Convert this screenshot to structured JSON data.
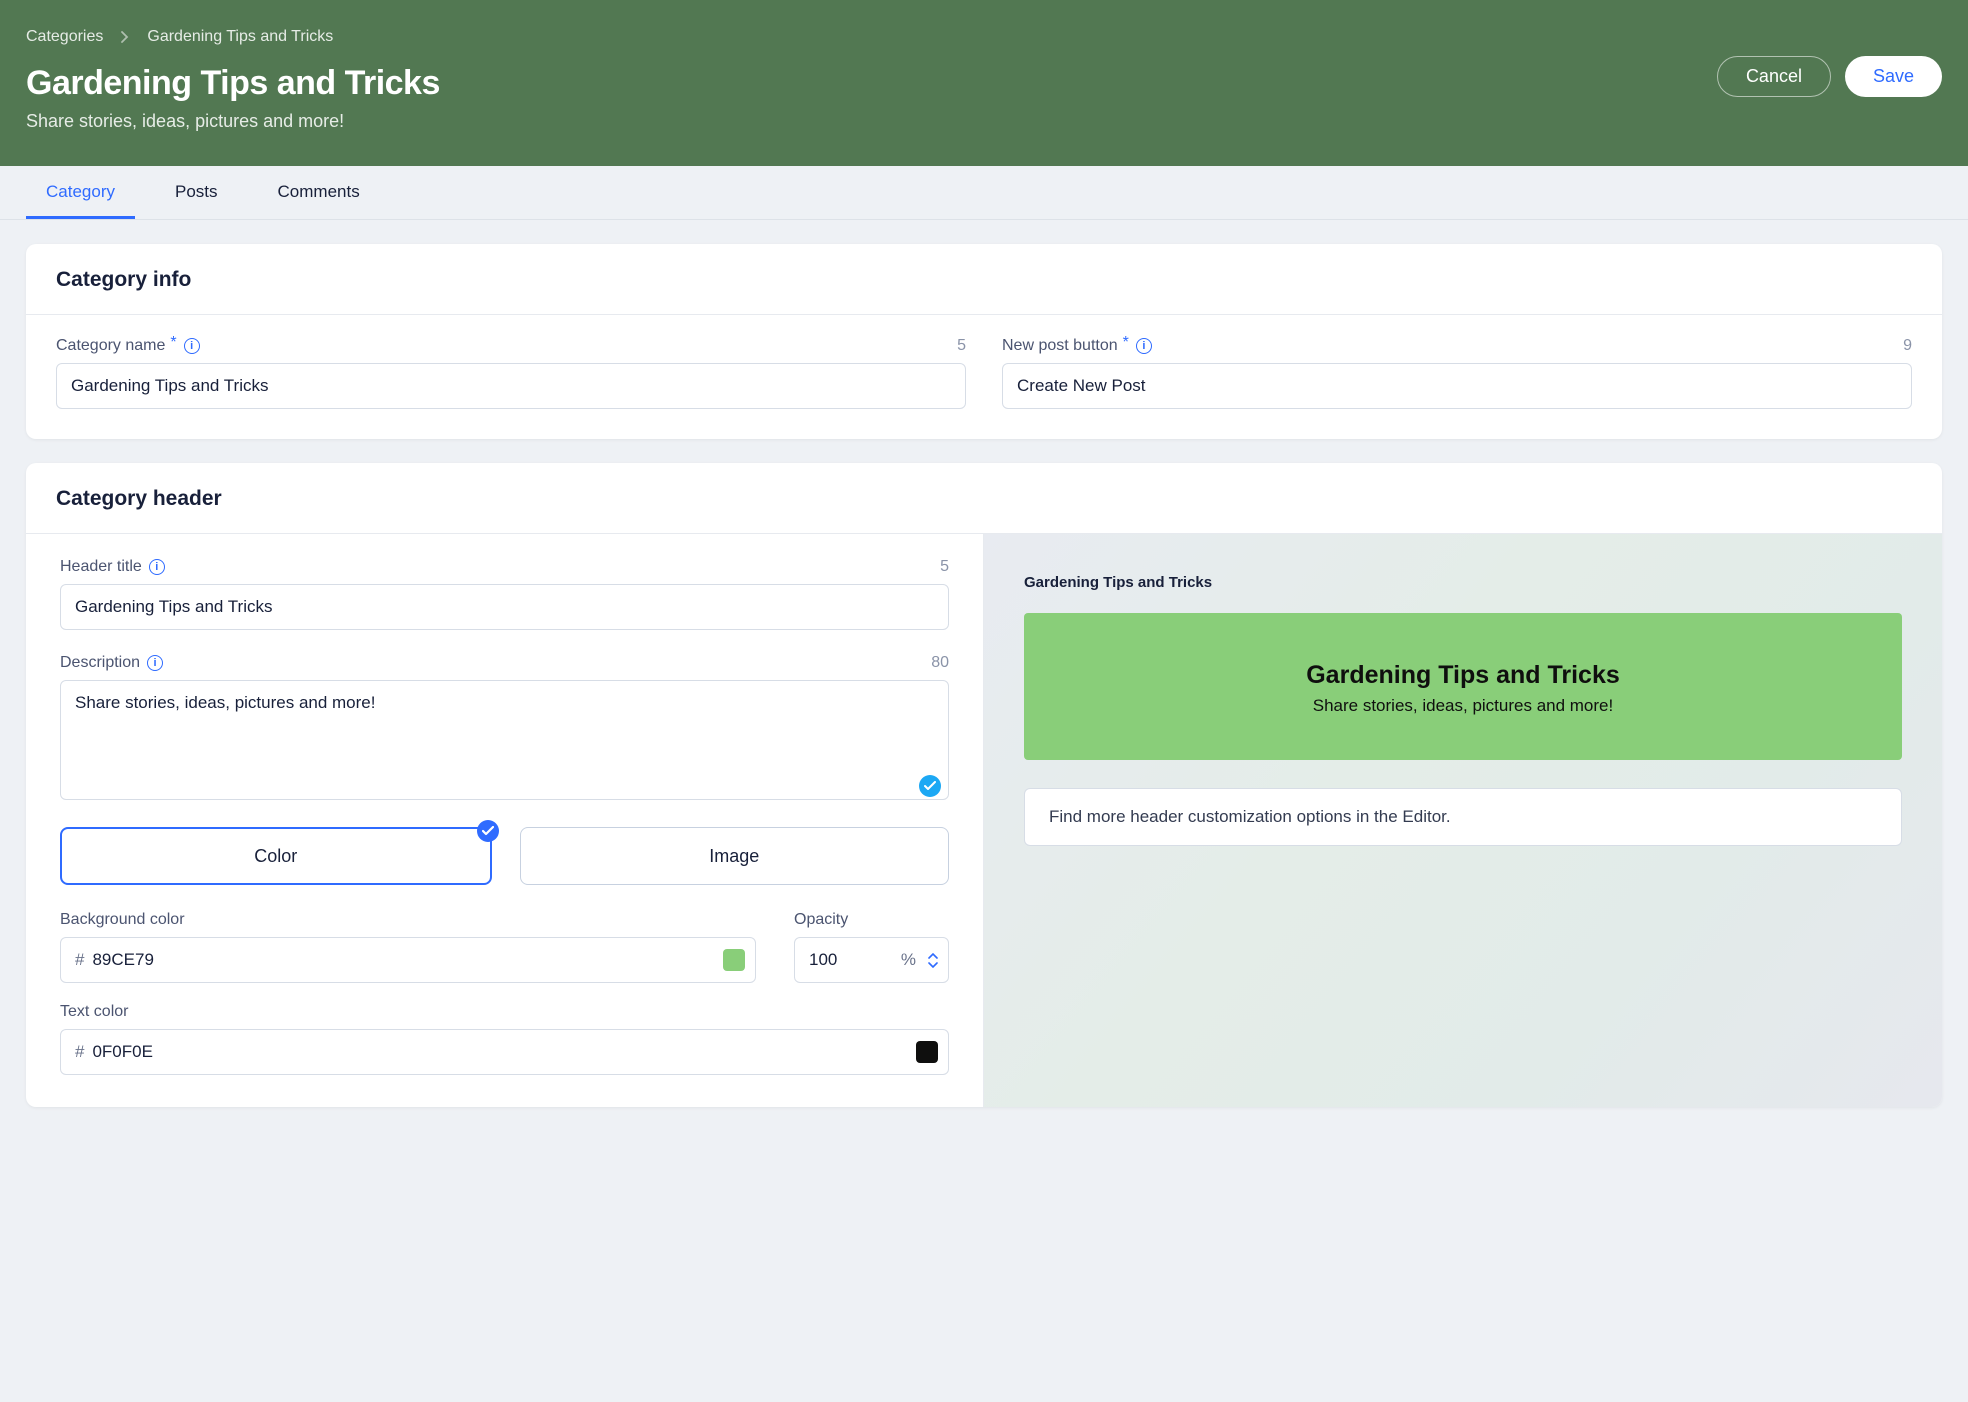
{
  "breadcrumb": {
    "parent": "Categories",
    "current": "Gardening Tips and Tricks"
  },
  "page": {
    "title": "Gardening Tips and Tricks",
    "subtitle": "Share stories, ideas, pictures and more!"
  },
  "actions": {
    "cancel": "Cancel",
    "save": "Save"
  },
  "tabs": {
    "category": "Category",
    "posts": "Posts",
    "comments": "Comments",
    "active": "category"
  },
  "category_info": {
    "section_title": "Category info",
    "name_label": "Category name",
    "name_value": "Gardening Tips and Tricks",
    "name_counter": "5",
    "button_label": "New post button",
    "button_value": "Create New Post",
    "button_counter": "9"
  },
  "category_header": {
    "section_title": "Category header",
    "header_title_label": "Header title",
    "header_title_value": "Gardening Tips and Tricks",
    "header_title_counter": "5",
    "description_label": "Description",
    "description_value": "Share stories, ideas, pictures and more!",
    "description_counter": "80",
    "toggle_color": "Color",
    "toggle_image": "Image",
    "bg_label": "Background color",
    "bg_value": "89CE79",
    "bg_swatch": "#89CE79",
    "opacity_label": "Opacity",
    "opacity_value": "100",
    "text_color_label": "Text color",
    "text_color_value": "0F0F0E",
    "text_color_swatch": "#0F0F0E"
  },
  "preview": {
    "breadcrumb": "Gardening Tips and Tricks",
    "hero_title": "Gardening Tips and Tricks",
    "hero_sub": "Share stories, ideas, pictures and more!",
    "hint": "Find more header customization options in the Editor."
  }
}
